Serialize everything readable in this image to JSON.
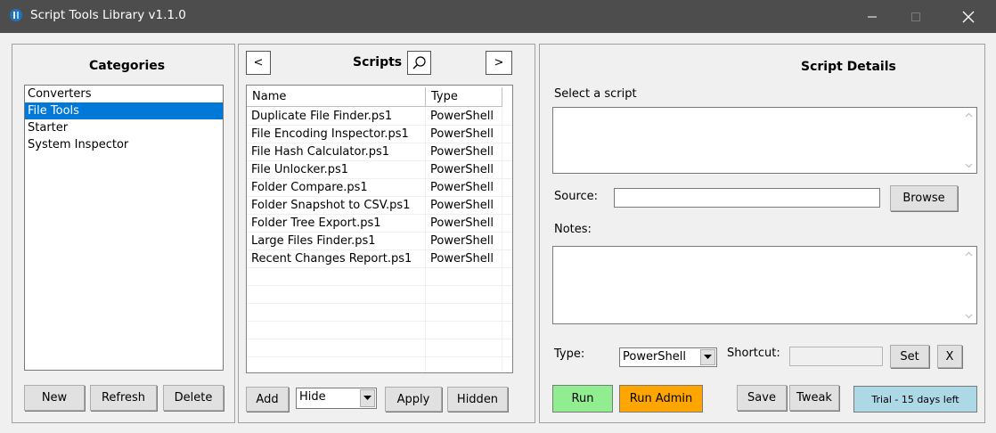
{
  "window": {
    "title": "Script Tools Library v1.1.0"
  },
  "categories": {
    "title": "Categories",
    "items": [
      "Converters",
      "File Tools",
      "Starter",
      "System Inspector"
    ],
    "selected_index": 1,
    "buttons": {
      "new": "New",
      "refresh": "Refresh",
      "delete": "Delete"
    }
  },
  "scripts": {
    "title": "Scripts",
    "prev_label": "<",
    "next_label": ">",
    "columns": [
      "Name",
      "Type"
    ],
    "rows": [
      {
        "name": "Duplicate File Finder.ps1",
        "type": "PowerShell"
      },
      {
        "name": "File Encoding Inspector.ps1",
        "type": "PowerShell"
      },
      {
        "name": "File Hash Calculator.ps1",
        "type": "PowerShell"
      },
      {
        "name": "File Unlocker.ps1",
        "type": "PowerShell"
      },
      {
        "name": "Folder Compare.ps1",
        "type": "PowerShell"
      },
      {
        "name": "Folder Snapshot to CSV.ps1",
        "type": "PowerShell"
      },
      {
        "name": "Folder Tree Export.ps1",
        "type": "PowerShell"
      },
      {
        "name": "Large Files Finder.ps1",
        "type": "PowerShell"
      },
      {
        "name": "Recent Changes Report.ps1",
        "type": "PowerShell"
      }
    ],
    "add_label": "Add",
    "filter_value": "Hide",
    "apply_label": "Apply",
    "hidden_label": "Hidden"
  },
  "details": {
    "title": "Script Details",
    "select_label": "Select a script",
    "source_label": "Source:",
    "source_value": "",
    "browse_label": "Browse",
    "notes_label": "Notes:",
    "notes_value": "",
    "type_label": "Type:",
    "type_value": "PowerShell",
    "shortcut_label": "Shortcut:",
    "shortcut_value": "",
    "set_label": "Set",
    "x_label": "X",
    "run_label": "Run",
    "run_admin_label": "Run Admin",
    "save_label": "Save",
    "tweak_label": "Tweak",
    "trial_label": "Trial - 15 days left"
  },
  "colors": {
    "selection": "#0078d7",
    "run": "#90ee90",
    "run_admin": "#ffa500",
    "trial": "#add8e6",
    "titlebar": "#4d4d4d"
  }
}
